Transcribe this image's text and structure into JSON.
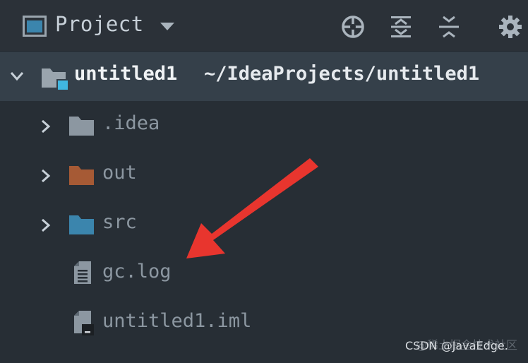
{
  "toolbar": {
    "title": "Project",
    "icons": {
      "view": "project-view-icon",
      "dropdown": "chevron-down-icon",
      "locate": "locate-icon",
      "expand": "expand-all-icon",
      "collapse": "collapse-all-icon",
      "settings": "gear-icon"
    }
  },
  "tree": {
    "root": {
      "name": "untitled1",
      "path": "~/IdeaProjects/untitled1",
      "icon": "module-folder-icon"
    },
    "items": [
      {
        "label": ".idea",
        "icon": "folder-icon",
        "color": "#8c97a1",
        "expandable": true
      },
      {
        "label": "out",
        "icon": "folder-icon",
        "color": "#a65a35",
        "expandable": true
      },
      {
        "label": "src",
        "icon": "folder-icon",
        "color": "#3b85ad",
        "expandable": true
      },
      {
        "label": "gc.log",
        "icon": "text-file-icon",
        "expandable": false
      },
      {
        "label": "untitled1.iml",
        "icon": "module-file-icon",
        "expandable": false
      }
    ]
  },
  "annotation": {
    "arrow_color": "#e8352e"
  },
  "watermark": {
    "text": "CSDN @JavaEdge.",
    "faint_text": "@稀土掘金技术社区"
  },
  "colors": {
    "background": "#272e35",
    "toolbar": "#2b3138",
    "selected_row": "#35404a"
  }
}
